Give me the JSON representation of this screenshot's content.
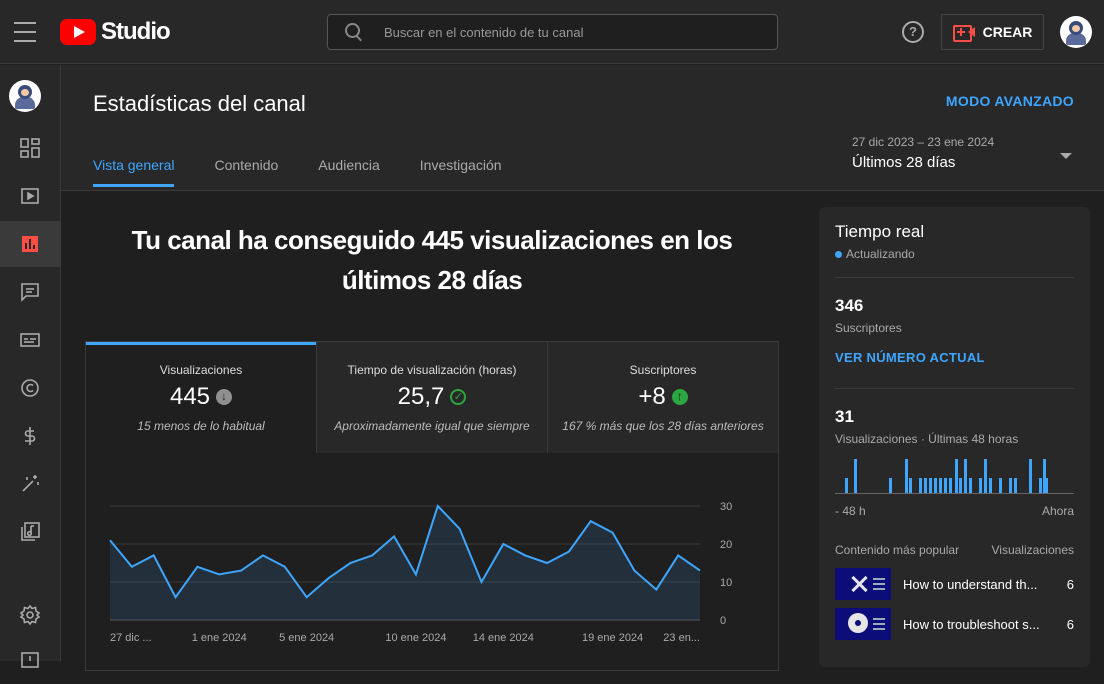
{
  "app": {
    "name": "Studio"
  },
  "search": {
    "placeholder": "Buscar en el contenido de tu canal"
  },
  "topbar": {
    "help_label": "?",
    "create_label": "CREAR"
  },
  "header": {
    "title": "Estadísticas del canal",
    "advanced_mode": "MODO AVANZADO",
    "tabs": [
      {
        "label": "Vista general",
        "active": true
      },
      {
        "label": "Contenido",
        "active": false
      },
      {
        "label": "Audiencia",
        "active": false
      },
      {
        "label": "Investigación",
        "active": false
      }
    ],
    "date_range": {
      "dates": "27 dic 2023 – 23 ene 2024",
      "period": "Últimos 28 días"
    }
  },
  "sidebar": {
    "items": [
      {
        "icon": "dashboard-icon"
      },
      {
        "icon": "content-icon"
      },
      {
        "icon": "analytics-icon",
        "active": true
      },
      {
        "icon": "comments-icon"
      },
      {
        "icon": "subtitles-icon"
      },
      {
        "icon": "copyright-icon"
      },
      {
        "icon": "monetization-icon"
      },
      {
        "icon": "customization-icon"
      },
      {
        "icon": "audio-library-icon"
      },
      {
        "icon": "settings-icon"
      },
      {
        "icon": "feedback-icon"
      }
    ]
  },
  "overview": {
    "headline": "Tu canal ha conseguido 445 visualizaciones en los últimos 28 días",
    "metrics": [
      {
        "title": "Visualizaciones",
        "value": "445",
        "indicator": "down",
        "note": "15 menos de lo habitual"
      },
      {
        "title": "Tiempo de visualización (horas)",
        "value": "25,7",
        "indicator": "check",
        "note": "Aproximadamente igual que siempre"
      },
      {
        "title": "Suscriptores",
        "value": "+8",
        "indicator": "up",
        "note": "167 % más que los 28 días anteriores"
      }
    ]
  },
  "chart_data": {
    "type": "area",
    "title": "",
    "xlabel": "",
    "ylabel": "",
    "x_tick_labels": [
      "27 dic ...",
      "1 ene 2024",
      "5 ene 2024",
      "10 ene 2024",
      "14 ene 2024",
      "19 ene 2024",
      "23 en..."
    ],
    "y_ticks": [
      0,
      10,
      20,
      30
    ],
    "ylim": [
      0,
      30
    ],
    "grid": true,
    "x": [
      "27 dic",
      "28 dic",
      "29 dic",
      "30 dic",
      "31 dic",
      "1 ene",
      "2 ene",
      "3 ene",
      "4 ene",
      "5 ene",
      "6 ene",
      "7 ene",
      "8 ene",
      "9 ene",
      "10 ene",
      "11 ene",
      "12 ene",
      "13 ene",
      "14 ene",
      "15 ene",
      "16 ene",
      "17 ene",
      "18 ene",
      "19 ene",
      "20 ene",
      "21 ene",
      "22 ene",
      "23 ene"
    ],
    "series": [
      {
        "values": [
          21,
          14,
          17,
          6,
          14,
          12,
          13,
          17,
          14,
          6,
          11,
          15,
          17,
          22,
          12,
          30,
          24,
          10,
          20,
          17,
          15,
          18,
          26,
          23,
          13,
          8,
          17,
          13
        ]
      }
    ],
    "color": "#3ea6ff"
  },
  "realtime": {
    "title": "Tiempo real",
    "status": "Actualizando",
    "subscribers": {
      "value": "346",
      "label": "Suscriptores"
    },
    "see_current": "VER NÚMERO ACTUAL",
    "views": {
      "value": "31",
      "label": "Visualizaciones · Últimas 48 horas"
    },
    "axis_start": "- 48 h",
    "axis_end": "Ahora",
    "hourly_views": [
      0,
      0,
      0,
      1,
      0,
      0,
      0,
      0,
      0,
      0,
      0,
      0,
      1,
      0,
      0,
      0,
      0,
      0,
      0,
      0,
      0,
      0,
      0,
      0,
      0,
      0,
      0,
      0,
      1,
      0,
      0,
      0,
      1,
      0,
      0,
      0,
      0,
      0,
      0,
      0,
      0,
      0,
      0,
      0,
      0,
      0,
      0,
      0,
      0,
      0,
      1,
      0,
      0,
      0,
      0,
      0,
      0,
      0,
      0,
      0,
      0,
      0,
      0,
      0,
      0,
      0,
      0,
      0,
      0,
      0,
      0,
      0,
      0,
      0,
      0,
      0,
      0,
      0,
      0,
      0,
      0,
      0,
      0,
      0,
      0,
      0,
      0,
      0,
      0,
      0,
      0,
      0,
      0,
      0,
      0,
      0,
      0,
      0
    ],
    "bars": [
      {
        "h": 1
      },
      {
        "h": 2
      },
      {
        "h": 1
      },
      {
        "h": 2
      },
      {
        "h": 1
      },
      {
        "h": 1
      },
      {
        "h": 1
      },
      {
        "h": 1
      },
      {
        "h": 1
      },
      {
        "h": 1
      },
      {
        "h": 1
      },
      {
        "h": 1
      },
      {
        "h": 2
      },
      {
        "h": 1
      },
      {
        "h": 2
      },
      {
        "h": 1
      },
      {
        "h": 1
      },
      {
        "h": 2
      },
      {
        "h": 1
      },
      {
        "h": 1
      },
      {
        "h": 1
      },
      {
        "h": 1
      },
      {
        "h": 2
      },
      {
        "h": 1
      },
      {
        "h": 2
      },
      {
        "h": 1
      }
    ],
    "popular_header": {
      "left": "Contenido más popular",
      "right": "Visualizaciones"
    },
    "popular": [
      {
        "title": "How to understand th...",
        "views": "6",
        "thumb": "x-thumbnail-icon"
      },
      {
        "title": "How to troubleshoot s...",
        "views": "6",
        "thumb": "disc-thumbnail-icon"
      }
    ]
  }
}
